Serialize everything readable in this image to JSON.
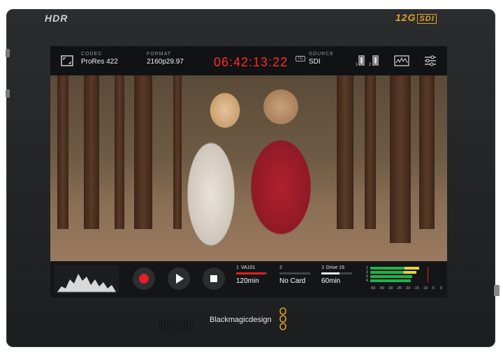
{
  "device": {
    "top_left_logo": "HDR",
    "top_right_logo": "12G",
    "top_right_logo_suffix": "SDI",
    "brand": "Blackmagicdesign"
  },
  "topbar": {
    "codec_label": "CODEC",
    "codec_value": "ProRes 422",
    "format_label": "FORMAT",
    "format_value": "2160p29.97",
    "timecode": "06:42:13:22",
    "tc_badge": "TC",
    "source_label": "SOURCE",
    "source_value": "SDI",
    "battery_1": "1",
    "battery_2": "2"
  },
  "slots": [
    {
      "num": "1",
      "name": "VA101",
      "value": "120min",
      "fill": 0.95,
      "color": "#e41e26"
    },
    {
      "num": "2",
      "name": "",
      "value": "No Card",
      "fill": 0.0,
      "color": "#888888"
    },
    {
      "num": "3",
      "name": "Drive 16",
      "value": "60min",
      "fill": 0.6,
      "color": "#e8e8e8"
    }
  ],
  "meters": {
    "channels": [
      "1",
      "2",
      "3",
      "4"
    ],
    "scale": [
      "-50",
      "-40",
      "-30",
      "-25",
      "-20",
      "-15",
      "-10",
      "-5",
      "0"
    ]
  },
  "colors": {
    "accent_red": "#e41e26",
    "timecode_red": "#ff2a2a",
    "logo_gold": "#e0a12a"
  }
}
